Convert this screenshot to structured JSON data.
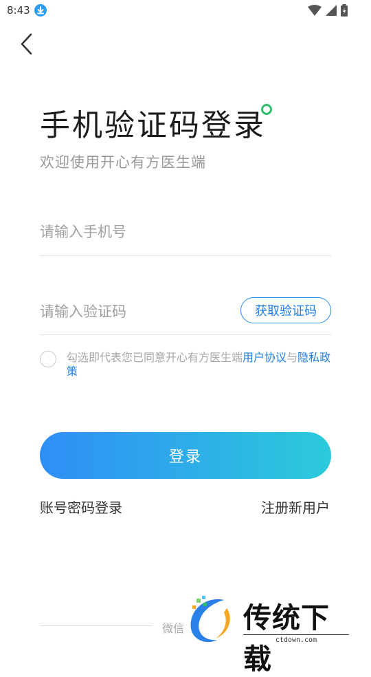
{
  "status_bar": {
    "time": "8:43"
  },
  "header": {
    "title": "手机验证码登录",
    "subtitle": "欢迎使用开心有方医生端"
  },
  "form": {
    "phone_placeholder": "请输入手机号",
    "code_placeholder": "请输入验证码",
    "get_code_label": "获取验证码"
  },
  "agreement": {
    "prefix": "勾选即代表您已同意开心有方医生端",
    "user_agreement": "用户协议",
    "conjunction": "与",
    "privacy_policy": "隐私政策"
  },
  "actions": {
    "login_label": "登录",
    "password_login_label": "账号密码登录",
    "register_label": "注册新用户"
  },
  "footer": {
    "wechat_text": "微信"
  },
  "watermark": {
    "brand": "传统下载",
    "url": "ctdown.com"
  },
  "colors": {
    "accent": "#2a8ff0",
    "gradient_start": "#2f8ef6",
    "gradient_end": "#2ccadb",
    "dot": "#2dbf6b"
  }
}
